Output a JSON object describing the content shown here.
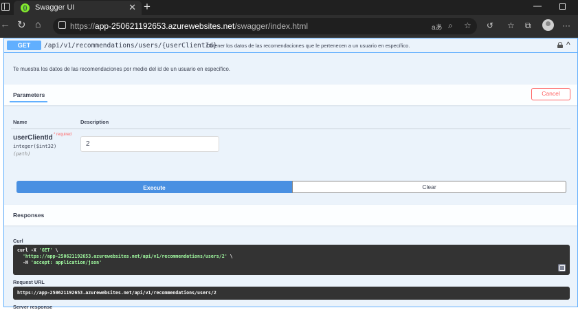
{
  "browser": {
    "tab_title": "Swagger UI",
    "url_prefix": "https://",
    "url_host": "app-250621192653.azurewebsites.net",
    "url_path": "/swagger/index.html",
    "reader_icon": "aあ"
  },
  "operation": {
    "method": "GET",
    "path": "/api/v1/recommendations/users/{userClientId}",
    "summary": "Obtener los datos de las recomendaciones que le pertenecen a un usuario en específico.",
    "description": "Te muestra los datos de las recomendaciones por medio del id de un usuario en específico."
  },
  "parameters": {
    "title": "Parameters",
    "cancel_label": "Cancel",
    "col_name": "Name",
    "col_description": "Description",
    "param_name": "userClientId",
    "param_required": "* required",
    "param_type": "integer($int32)",
    "param_in": "(path)",
    "param_value": "2"
  },
  "actions": {
    "execute_label": "Execute",
    "clear_label": "Clear"
  },
  "responses": {
    "title": "Responses",
    "curl_label": "Curl",
    "curl_line1_cmd": "curl -X ",
    "curl_line1_method": "'GET'",
    "curl_line1_end": " \\",
    "curl_line2_url": "'https://app-250621192653.azurewebsites.net/api/v1/recommendations/users/2'",
    "curl_line2_end": " \\",
    "curl_line3_flag": "  -H ",
    "curl_line3_header": "'accept: application/json'",
    "request_url_label": "Request URL",
    "request_url": "https://app-250621192653.azurewebsites.net/api/v1/recommendations/users/2",
    "server_response_label": "Server response"
  }
}
